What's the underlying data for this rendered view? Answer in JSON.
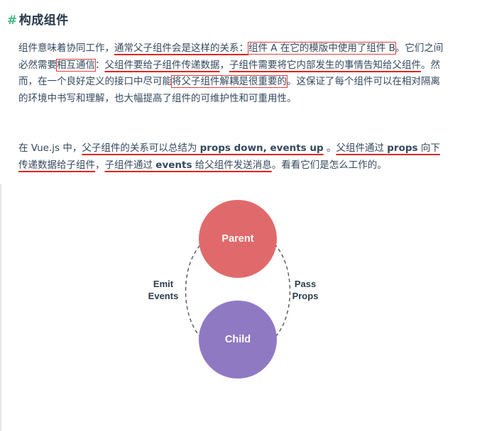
{
  "heading": {
    "hash": "#",
    "title": "构成组件"
  },
  "paragraph1": {
    "s1": "组件意味着协同工作，",
    "s2": "通常父子组件会是这样的关系：",
    "s3": "组件 A 在它的模版中使用了组件 B",
    "s4": "。它们之间必然需要",
    "s5": "相互通信",
    "s6": "：",
    "s7": "父组件要给子组件传递数据",
    "s8": "，",
    "s9": "子组件需要将它内部发生的事情告知给父组件",
    "s10": "。然而，在一个良好定义的接口中尽可能",
    "s11": "将父子组件解耦是很重要的",
    "s12": "。这保证了每个组件可以在相对隔离的环境中书写和理解，也大幅提高了组件的可维护性和可重用性。"
  },
  "paragraph2": {
    "s1": "在 Vue.js 中，",
    "s2": "父子组件的关系可以总结为 ",
    "s3": "props down, events up",
    "s4": " 。",
    "s5": "父组件通过 ",
    "s6": "props",
    "s7": " 向下传递数据给子组件",
    "s8": "，",
    "s9": "子组件通过 ",
    "s10": "events",
    "s11": " 给父组件发送消息",
    "s12": "。看看它们是怎么工作的。"
  },
  "diagram": {
    "parent_label": "Parent",
    "child_label": "Child",
    "left_label_line1": "Emit",
    "left_label_line2": "Events",
    "right_label_line1": "Pass",
    "right_label_line2": "Props",
    "parent_color": "#e06a6b",
    "child_color": "#8f79c3",
    "annotation_color": "#e0251f"
  }
}
